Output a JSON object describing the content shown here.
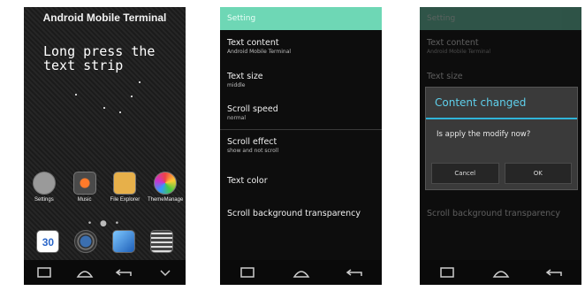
{
  "home": {
    "title": "Android Mobile Terminal",
    "strip_text": "Long press the\ntext strip",
    "apps": [
      "Settings",
      "Music",
      "File Explorer",
      "ThemeManage"
    ],
    "dock_calendar_day": "30"
  },
  "settings": {
    "header": "Setting",
    "items": [
      {
        "title": "Text content",
        "subtitle": "Android Mobile Terminal"
      },
      {
        "title": "Text size",
        "subtitle": "middle"
      },
      {
        "title": "Scroll speed",
        "subtitle": "normal"
      },
      {
        "title": "Scroll effect",
        "subtitle": "show and not scroll"
      },
      {
        "title": "Text color",
        "subtitle": ""
      },
      {
        "title": "Scroll background transparency",
        "subtitle": ""
      }
    ]
  },
  "dialog": {
    "title": "Content changed",
    "message": "Is apply the modify now?",
    "cancel": "Cancel",
    "ok": "OK"
  },
  "colors": {
    "accent_bar": "#6ed7b5",
    "dialog_title": "#5fd0ec"
  }
}
